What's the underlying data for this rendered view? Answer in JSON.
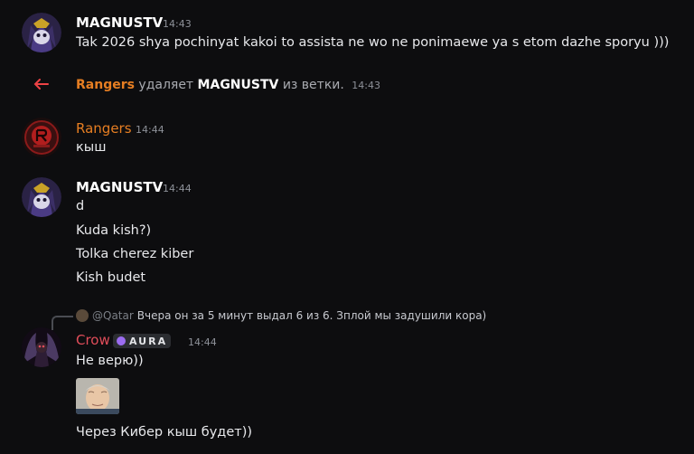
{
  "messages": [
    {
      "author": "MAGNUSTV",
      "time": "14:43",
      "lines": [
        "Tak 2026 shya pochinyat kakoi to assista ne wo ne ponimaewe ya s etom dazhe sporyu )))"
      ]
    },
    {
      "author": "Rangers",
      "time": "14:44",
      "lines": [
        "кыш"
      ]
    },
    {
      "author": "MAGNUSTV",
      "time": "14:44",
      "lines": [
        "d",
        "Kuda kish?)",
        "Tolka cherez kiber",
        "Kish budet"
      ]
    },
    {
      "author": "Crow",
      "time": "14:44",
      "lines": [
        "Не верю))",
        "Через Кибер кыш будет))"
      ]
    }
  ],
  "system": {
    "actor": "Rangers",
    "action": "удаляет",
    "target": "MAGNUSTV",
    "suffix": "из ветки.",
    "time": "14:43"
  },
  "reply": {
    "mention": "@Qatar",
    "text": "Вчера он за 5 минут выдал 6 из 6. Зплой мы задушили кора)"
  },
  "crow_badge": {
    "label": "AURA"
  },
  "colors": {
    "background": "#0d0d0f",
    "orange_role": "#e67e22",
    "crow_role": "#e04d5a",
    "remove_arrow": "#ed4245",
    "timestamp": "#8e9199"
  },
  "icons": [
    "arrow-left-icon",
    "aura-badge-icon",
    "magnustv-avatar",
    "rangers-avatar",
    "crow-avatar",
    "meme-image"
  ]
}
